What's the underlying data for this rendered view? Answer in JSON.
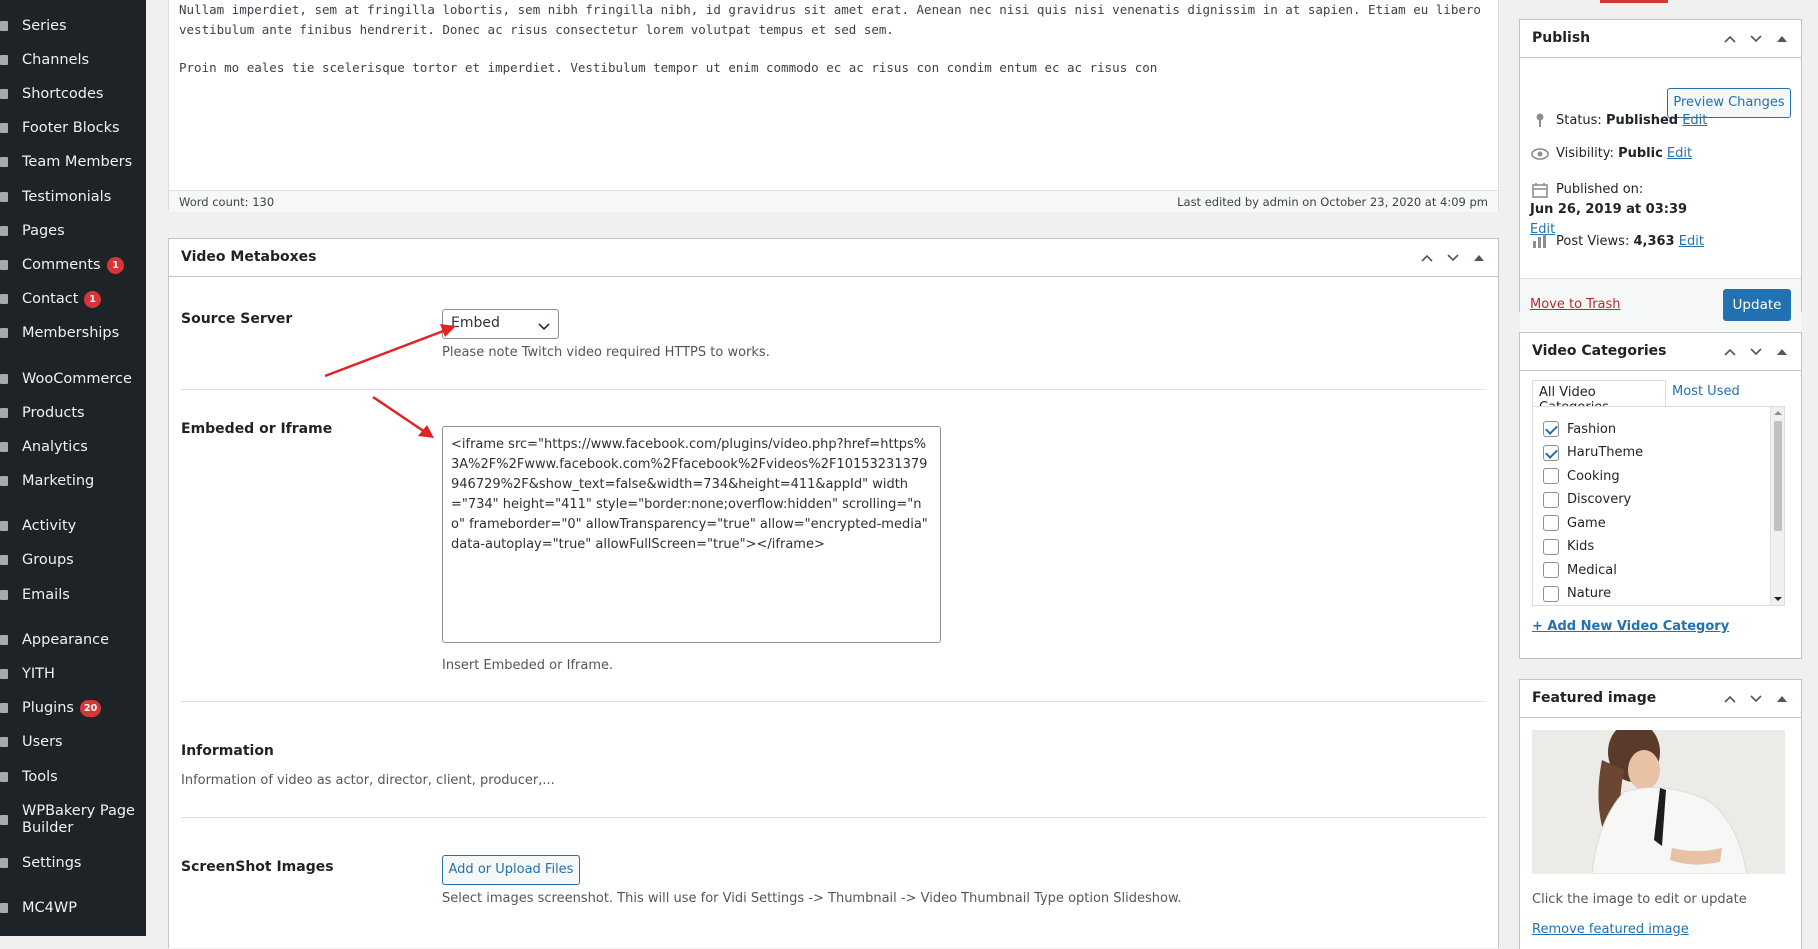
{
  "sidebar": {
    "items": [
      {
        "label": "Series",
        "icon": "series-icon",
        "badge": ""
      },
      {
        "label": "Channels",
        "icon": "channels-icon",
        "badge": ""
      },
      {
        "label": "Shortcodes",
        "icon": "shortcodes-icon",
        "badge": ""
      },
      {
        "label": "Footer Blocks",
        "icon": "footer-blocks-icon",
        "badge": ""
      },
      {
        "label": "Team Members",
        "icon": "team-members-icon",
        "badge": ""
      },
      {
        "label": "Testimonials",
        "icon": "testimonials-icon",
        "badge": ""
      },
      {
        "label": "Pages",
        "icon": "pages-icon",
        "badge": ""
      },
      {
        "label": "Comments",
        "icon": "comments-icon",
        "badge": "1"
      },
      {
        "label": "Contact",
        "icon": "contact-icon",
        "badge": "1"
      },
      {
        "label": "Memberships",
        "icon": "memberships-icon",
        "badge": ""
      },
      {
        "label": "WooCommerce",
        "icon": "woocommerce-icon",
        "badge": ""
      },
      {
        "label": "Products",
        "icon": "products-icon",
        "badge": ""
      },
      {
        "label": "Analytics",
        "icon": "analytics-icon",
        "badge": ""
      },
      {
        "label": "Marketing",
        "icon": "marketing-icon",
        "badge": ""
      },
      {
        "label": "Activity",
        "icon": "activity-icon",
        "badge": ""
      },
      {
        "label": "Groups",
        "icon": "groups-icon",
        "badge": ""
      },
      {
        "label": "Emails",
        "icon": "emails-icon",
        "badge": ""
      },
      {
        "label": "Appearance",
        "icon": "appearance-icon",
        "badge": ""
      },
      {
        "label": "YITH",
        "icon": "yith-icon",
        "badge": ""
      },
      {
        "label": "Plugins",
        "icon": "plugins-icon",
        "badge": "20"
      },
      {
        "label": "Users",
        "icon": "users-icon",
        "badge": ""
      },
      {
        "label": "Tools",
        "icon": "tools-icon",
        "badge": ""
      },
      {
        "label": "WPBakery Page Builder",
        "icon": "wpbakery-icon",
        "badge": ""
      },
      {
        "label": "Settings",
        "icon": "settings-icon",
        "badge": ""
      },
      {
        "label": "MC4WP",
        "icon": "mc4wp-icon",
        "badge": ""
      }
    ]
  },
  "editor": {
    "line1": "Nullam imperdiet, sem at fringilla lobortis, sem nibh fringilla nibh, id gravidrus sit amet erat. Aenean nec nisi quis nisi venenatis dignissim in at sapien. Etiam eu libero vestibulum ante finibus hendrerit. Donec ac risus consectetur lorem volutpat tempus et sed sem.",
    "line2": "Proin mo eales tie scelerisque tortor et imperdiet. Vestibulum tempor ut enim commodo ec ac risus con condim entum ec ac risus con",
    "word_count": "Word count: 130",
    "last_edited": "Last edited by admin on October 23, 2020 at 4:09 pm"
  },
  "video_metaboxes": {
    "title": "Video Metaboxes",
    "source_label": "Source Server",
    "source_value": "Embed",
    "source_note": "Please note Twitch video required HTTPS to works.",
    "embed_label": "Embeded or Iframe",
    "embed_value": "<iframe src=\"https://www.facebook.com/plugins/video.php?href=https%3A%2F%2Fwww.facebook.com%2Ffacebook%2Fvideos%2F10153231379946729%2F&show_text=false&width=734&height=411&appId\" width=\"734\" height=\"411\" style=\"border:none;overflow:hidden\" scrolling=\"no\" frameborder=\"0\" allowTransparency=\"true\" allow=\"encrypted-media\" data-autoplay=\"true\" allowFullScreen=\"true\"></iframe>",
    "embed_note": "Insert Embeded or Iframe.",
    "info_label": "Information",
    "info_desc": "Information of video as actor, director, client, producer,...",
    "screenshot_label": "ScreenShot Images",
    "upload_button": "Add or Upload Files",
    "screenshot_desc": "Select images screenshot. This will use for Vidi Settings -> Thumbnail -> Video Thumbnail Type option Slideshow."
  },
  "publish": {
    "title": "Publish",
    "preview_button": "Preview Changes",
    "status_label": "Status:",
    "status_value": "Published",
    "visibility_label": "Visibility:",
    "visibility_value": "Public",
    "published_label": "Published on:",
    "published_value": "Jun 26, 2019 at 03:39",
    "views_label": "Post Views:",
    "views_value": "4,363",
    "edit_link": "Edit",
    "trash_link": "Move to Trash",
    "update_button": "Update"
  },
  "categories": {
    "title": "Video Categories",
    "tab_all": "All Video Categories",
    "tab_used": "Most Used",
    "items": [
      {
        "label": "Fashion",
        "checked": true
      },
      {
        "label": "HaruTheme",
        "checked": true
      },
      {
        "label": "Cooking",
        "checked": false
      },
      {
        "label": "Discovery",
        "checked": false
      },
      {
        "label": "Game",
        "checked": false
      },
      {
        "label": "Kids",
        "checked": false
      },
      {
        "label": "Medical",
        "checked": false
      },
      {
        "label": "Nature",
        "checked": false
      }
    ],
    "add_link": "+ Add New Video Category"
  },
  "featured": {
    "title": "Featured image",
    "caption": "Click the image to edit or update",
    "remove_link": "Remove featured image"
  },
  "colors": {
    "sidebar_bg": "#1d2327",
    "accent": "#2271b1",
    "badge": "#d63638",
    "arrow": "#e02424"
  }
}
